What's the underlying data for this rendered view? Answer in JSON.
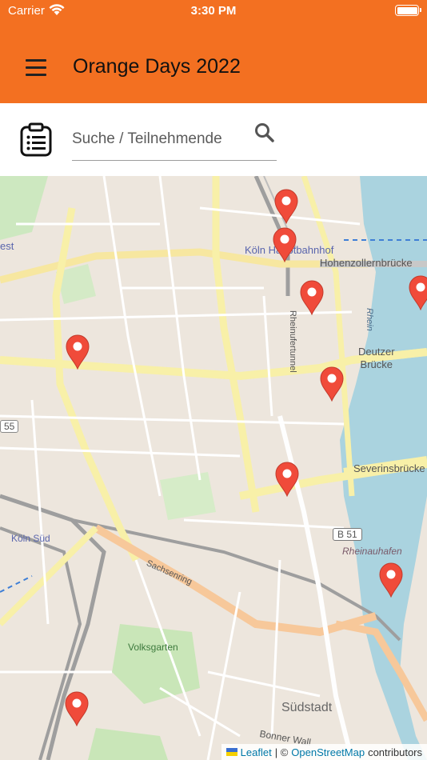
{
  "status_bar": {
    "carrier": "Carrier",
    "time": "3:30 PM"
  },
  "header": {
    "title": "Orange Days 2022"
  },
  "search": {
    "placeholder": "Suche / Teilnehmende",
    "value": ""
  },
  "map": {
    "labels": {
      "koeln_hbf": "Köln Hauptbahnhof",
      "hohenzollernbruecke": "Hohenzollernbrücke",
      "rheinufertunnel": "Rheinufertunnel",
      "rhein": "Rhein",
      "deutzer_bruecke": "Deutzer\nBrücke",
      "severinsbruecke": "Severinsbrücke",
      "koeln_sued": "Köln Süd",
      "b51": "B 51",
      "rheinauhafen": "Rheinauhafen",
      "sachsenring": "Sachsenring",
      "volksgarten": "Volksgarten",
      "suedstadt": "Südstadt",
      "bonner_wall": "Bonner Wall",
      "route_55": "55",
      "west": "est"
    },
    "markers": [
      {
        "id": 1,
        "color": "#f04b3a"
      },
      {
        "id": 2,
        "color": "#f04b3a"
      },
      {
        "id": 3,
        "color": "#f04b3a"
      },
      {
        "id": 4,
        "color": "#f04b3a"
      },
      {
        "id": 5,
        "color": "#f04b3a"
      },
      {
        "id": 6,
        "color": "#f04b3a"
      },
      {
        "id": 7,
        "color": "#f04b3a"
      },
      {
        "id": 8,
        "color": "#f04b3a"
      },
      {
        "id": 9,
        "color": "#f04b3a"
      }
    ]
  },
  "attribution": {
    "leaflet": "Leaflet",
    "separator": "| ©",
    "osm": "OpenStreetMap",
    "suffix": "contributors"
  },
  "colors": {
    "header": "#f37021",
    "marker": "#f04b3a",
    "river": "#aad3df",
    "road_major": "#f8f0a8"
  }
}
